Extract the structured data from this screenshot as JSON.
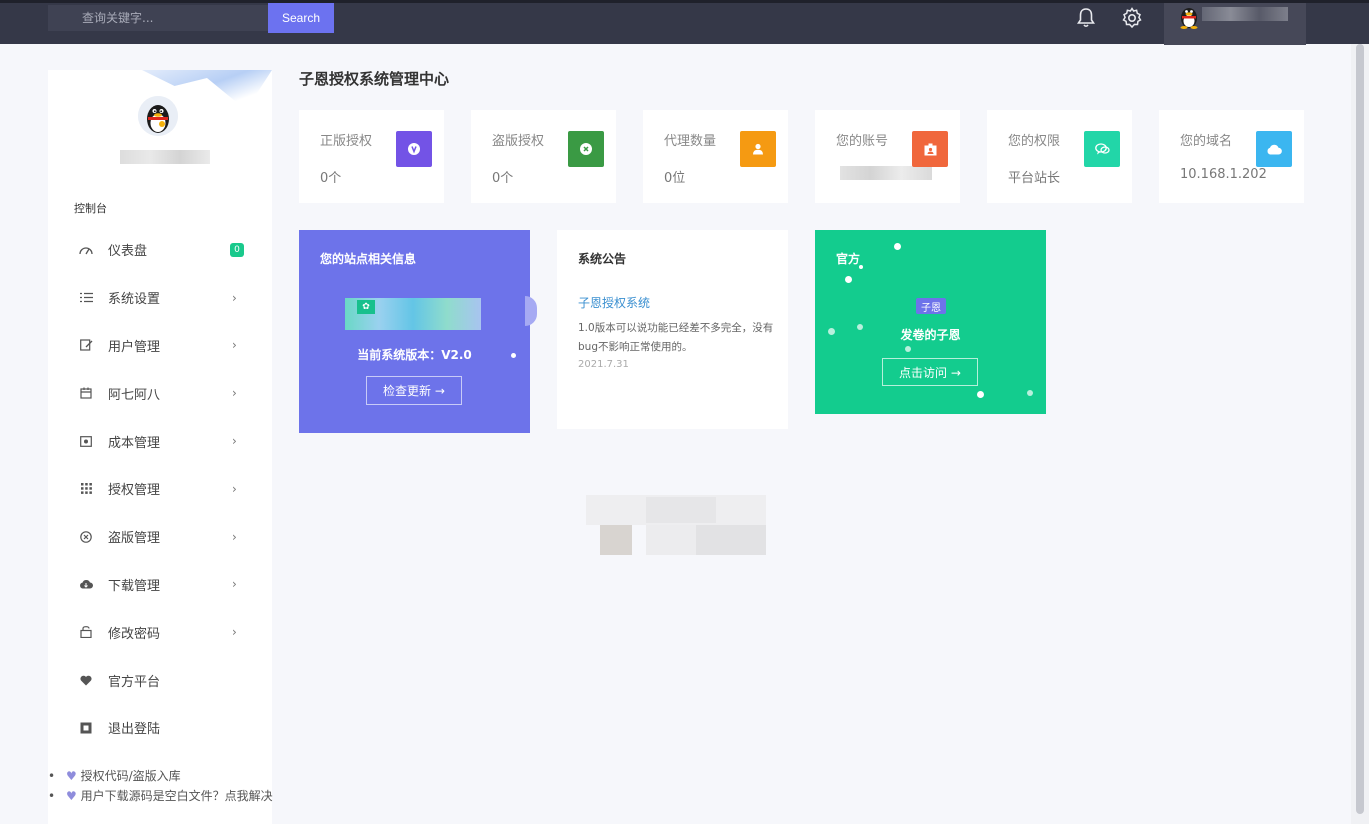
{
  "topbar": {
    "search_placeholder": "查询关键字...",
    "search_button": "Search"
  },
  "sidebar": {
    "section_label": "控制台",
    "menu": [
      {
        "label": "仪表盘",
        "icon": "dashboard-icon",
        "badge": "0"
      },
      {
        "label": "系统设置",
        "icon": "list-icon"
      },
      {
        "label": "用户管理",
        "icon": "user-edit-icon"
      },
      {
        "label": "阿七阿八",
        "icon": "calendar-icon"
      },
      {
        "label": "成本管理",
        "icon": "money-icon"
      },
      {
        "label": "授权管理",
        "icon": "grid-icon"
      },
      {
        "label": "盗版管理",
        "icon": "close-circle-icon"
      },
      {
        "label": "下载管理",
        "icon": "cloud-download-icon"
      },
      {
        "label": "修改密码",
        "icon": "lock-icon"
      },
      {
        "label": "官方平台",
        "icon": "heart-icon"
      },
      {
        "label": "退出登陆",
        "icon": "logout-icon"
      }
    ],
    "footer_links": [
      "授权代码/盗版入库",
      "用户下载源码是空白文件？点我解决"
    ]
  },
  "main": {
    "title": "子恩授权系统管理中心",
    "stats": [
      {
        "label": "正版授权",
        "value": "0个",
        "icon": "key-icon",
        "color": "#7353e6"
      },
      {
        "label": "盗版授权",
        "value": "0个",
        "icon": "close-icon",
        "color": "#3a9a44"
      },
      {
        "label": "代理数量",
        "value": "0位",
        "icon": "user-icon",
        "color": "#f59a12"
      },
      {
        "label": "您的账号",
        "value": "",
        "icon": "id-badge-icon",
        "color": "#f0673c"
      },
      {
        "label": "您的权限",
        "value": "平台站长",
        "icon": "chat-icon",
        "color": "#22d6a8"
      },
      {
        "label": "您的域名",
        "value": "10.168.1.202",
        "icon": "cloud-icon",
        "color": "#3bb6f0"
      }
    ],
    "site_card": {
      "title": "您的站点相关信息",
      "version": "当前系统版本：V2.0",
      "button": "检查更新"
    },
    "notice_card": {
      "title": "系统公告",
      "link": "子恩授权系统",
      "body": "1.0版本可以说功能已经差不多完全，没有bug不影响正常使用的。",
      "date": "2021.7.31"
    },
    "official_card": {
      "title": "官方",
      "badge": "子恩",
      "subtitle": "发卷的子恩",
      "button": "点击访问"
    }
  }
}
